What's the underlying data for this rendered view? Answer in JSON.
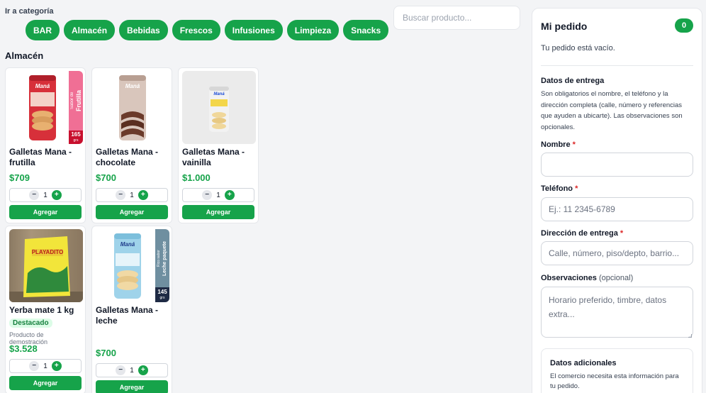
{
  "categories": {
    "label": "Ir a categoría",
    "items": [
      "BAR",
      "Almacén",
      "Bebidas",
      "Frescos",
      "Infusiones",
      "Limpieza",
      "Snacks"
    ]
  },
  "search": {
    "placeholder": "Buscar producto..."
  },
  "section": {
    "title": "Almacén"
  },
  "products": [
    {
      "name": "Galletas Mana - frutilla",
      "price": "$709",
      "qty": "1",
      "add_label": "Agregar",
      "tag_main": "Frutilla",
      "tag_sub": "Sabor de",
      "weight": "165",
      "weight_unit": "grs",
      "brand": "Maná"
    },
    {
      "name": "Galletas Mana - chocolate",
      "price": "$700",
      "qty": "1",
      "add_label": "Agregar",
      "brand": "Maná"
    },
    {
      "name": "Galletas Mana - vainilla",
      "price": "$1.000",
      "qty": "1",
      "add_label": "Agregar",
      "brand": "Maná"
    },
    {
      "name": "Yerba mate 1 kg",
      "badge": "Destacado",
      "note": "Producto de demostración",
      "price": "$3.528",
      "qty": "1",
      "add_label": "Agregar",
      "brand": "PLAYADITO"
    },
    {
      "name": "Galletas Mana - leche",
      "price": "$700",
      "qty": "1",
      "add_label": "Agregar",
      "tag_main": "Leche paquete",
      "tag_sub": "Rico sabor",
      "weight": "145",
      "weight_unit": "grs",
      "brand": "Maná"
    }
  ],
  "order": {
    "title": "Mi pedido",
    "count": "0",
    "empty": "Tu pedido está vacío.",
    "delivery_title": "Datos de entrega",
    "delivery_desc": "Son obligatorios el nombre, el teléfono y la dirección completa (calle, número y referencias que ayuden a ubicarte). Las observaciones son opcionales.",
    "name_label": "Nombre",
    "phone_label": "Teléfono",
    "phone_placeholder": "Ej.: 11 2345-6789",
    "address_label": "Dirección de entrega",
    "address_placeholder": "Calle, número, piso/depto, barrio...",
    "notes_label": "Observaciones",
    "notes_optional": "(opcional)",
    "notes_placeholder": "Horario preferido, timbre, datos extra...",
    "required_mark": "*",
    "extra_title": "Datos adicionales",
    "extra_desc": "El comercio necesita esta información para tu pedido."
  },
  "colors": {
    "accent": "#16a34a",
    "required": "#dc2626",
    "price": "#16a34a"
  }
}
